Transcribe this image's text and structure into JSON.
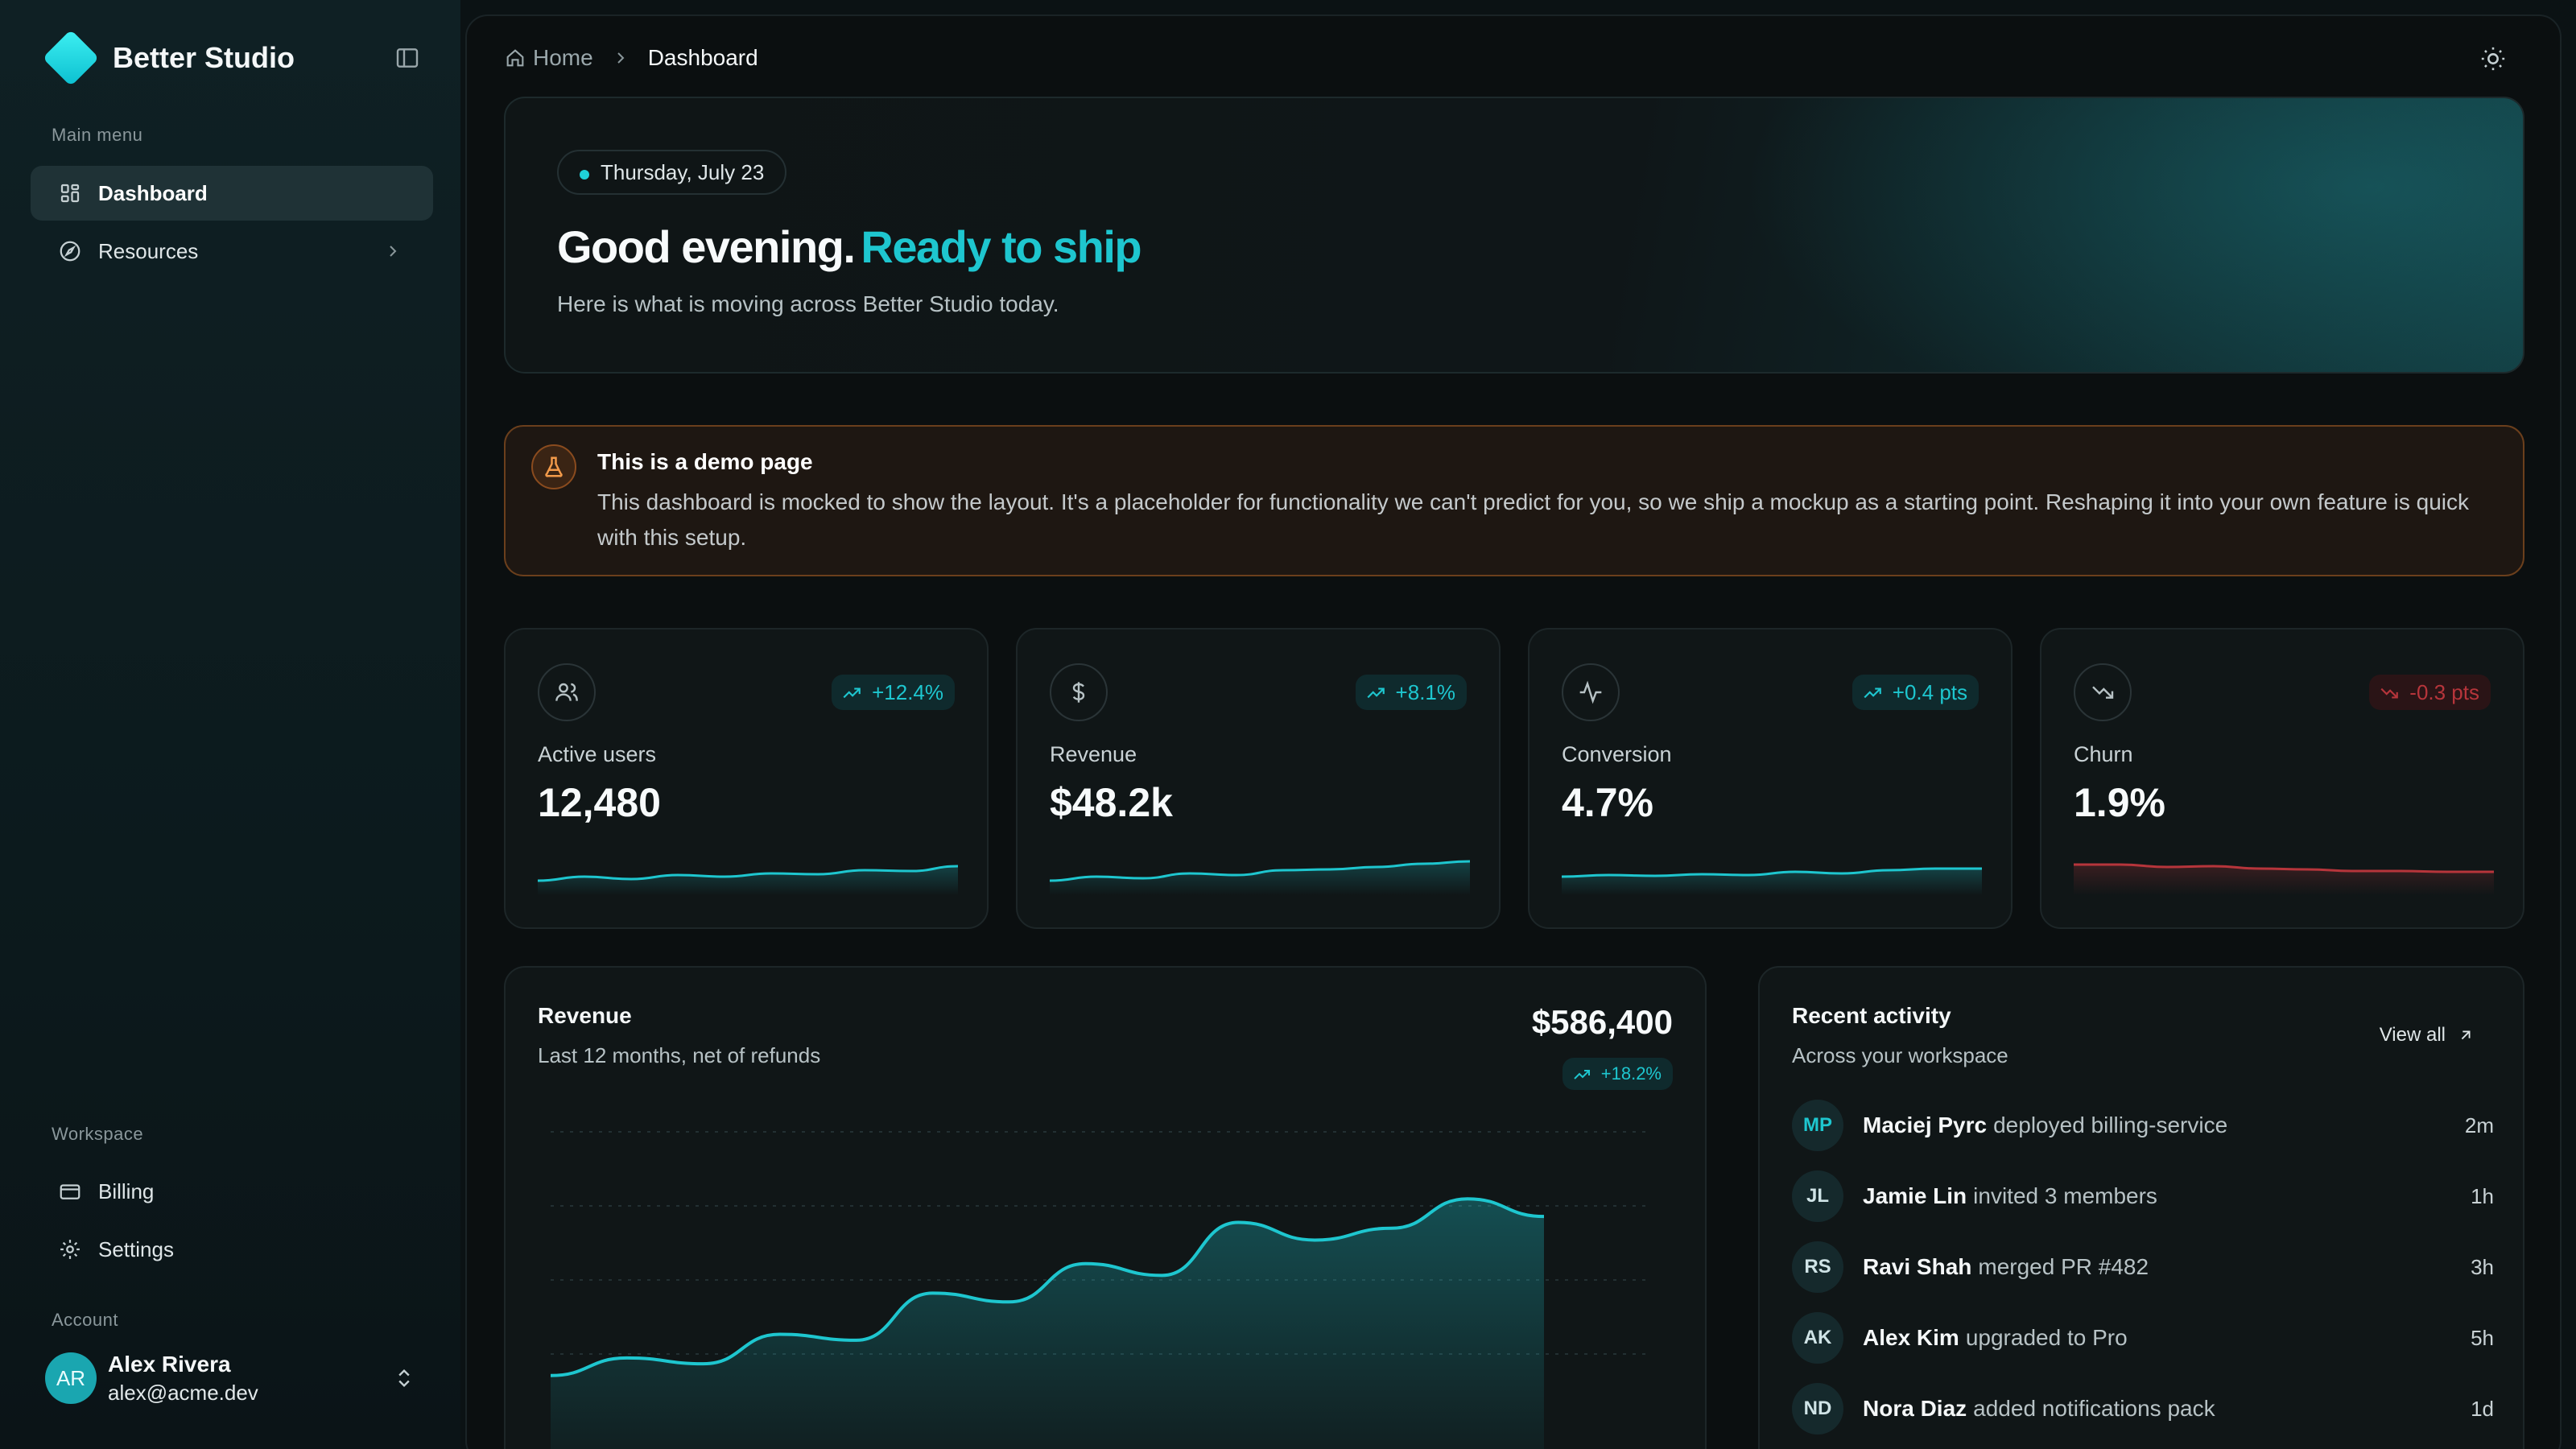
{
  "brand": {
    "name": "Better Studio",
    "accent": "#1ec6cf"
  },
  "sidebar": {
    "main_label": "Main menu",
    "items": [
      {
        "label": "Dashboard",
        "icon": "grid-icon"
      },
      {
        "label": "Resources",
        "icon": "compass-icon"
      }
    ],
    "workspace_label": "Workspace",
    "workspace_items": [
      {
        "label": "Billing",
        "icon": "credit-card-icon"
      },
      {
        "label": "Settings",
        "icon": "gear-icon"
      }
    ],
    "account_label": "Account",
    "user": {
      "initials": "AR",
      "name": "Alex Rivera",
      "email": "alex@acme.dev"
    }
  },
  "breadcrumb": {
    "home": "Home",
    "current": "Dashboard"
  },
  "hero": {
    "date": "Thursday, July 23",
    "greeting": "Good evening.",
    "accent": "Ready to ship",
    "subtitle": "Here is what is moving across Better Studio today."
  },
  "demo": {
    "title": "This is a demo page",
    "body": "This dashboard is mocked to show the layout. It's a placeholder for functionality we can't predict for you, so we ship a mockup as a starting point. Reshaping it into your own feature is quick with this setup."
  },
  "stats": [
    {
      "label": "Active users",
      "value": "12,480",
      "delta": "+12.4%",
      "trend": "up",
      "icon": "users-icon",
      "spark": [
        2,
        3,
        2.4,
        3.4,
        3,
        3.8,
        3.6,
        4.6,
        4.4,
        5.6
      ]
    },
    {
      "label": "Revenue",
      "value": "$48.2k",
      "delta": "+8.1%",
      "trend": "up",
      "icon": "dollar-icon",
      "spark": [
        2,
        3,
        2.6,
        3.8,
        3.4,
        4.6,
        4.8,
        5.4,
        6.2,
        6.8
      ]
    },
    {
      "label": "Conversion",
      "value": "4.7%",
      "delta": "+0.4 pts",
      "trend": "up",
      "icon": "activity-icon",
      "spark": [
        3,
        3.4,
        3.2,
        3.6,
        3.4,
        4.2,
        3.8,
        4.6,
        5,
        5
      ]
    },
    {
      "label": "Churn",
      "value": "1.9%",
      "delta": "-0.3 pts",
      "trend": "down",
      "icon": "trending-down-icon",
      "spark": [
        6,
        6,
        5.4,
        5.6,
        5,
        4.8,
        4.4,
        4.4,
        4.2,
        4.2
      ]
    }
  ],
  "revenue": {
    "title": "Revenue",
    "subtitle": "Last 12 months, net of refunds",
    "total": "$586,400",
    "delta": "+18.2%"
  },
  "chart_data": {
    "type": "area",
    "title": "Revenue",
    "values": [
      20,
      26,
      24,
      34,
      32,
      48,
      45,
      58,
      54,
      72,
      66,
      70,
      80,
      74
    ],
    "color": "#1ec6cf",
    "grid": true
  },
  "activity": {
    "title": "Recent activity",
    "subtitle": "Across your workspace",
    "view_all": "View all",
    "items": [
      {
        "initials": "MP",
        "name": "Maciej Pyrc",
        "action": "deployed billing-service",
        "time": "2m",
        "teal": true
      },
      {
        "initials": "JL",
        "name": "Jamie Lin",
        "action": "invited 3 members",
        "time": "1h",
        "teal": false
      },
      {
        "initials": "RS",
        "name": "Ravi Shah",
        "action": "merged PR #482",
        "time": "3h",
        "teal": false
      },
      {
        "initials": "AK",
        "name": "Alex Kim",
        "action": "upgraded to Pro",
        "time": "5h",
        "teal": false
      },
      {
        "initials": "ND",
        "name": "Nora Diaz",
        "action": "added notifications pack",
        "time": "1d",
        "teal": false
      }
    ]
  }
}
